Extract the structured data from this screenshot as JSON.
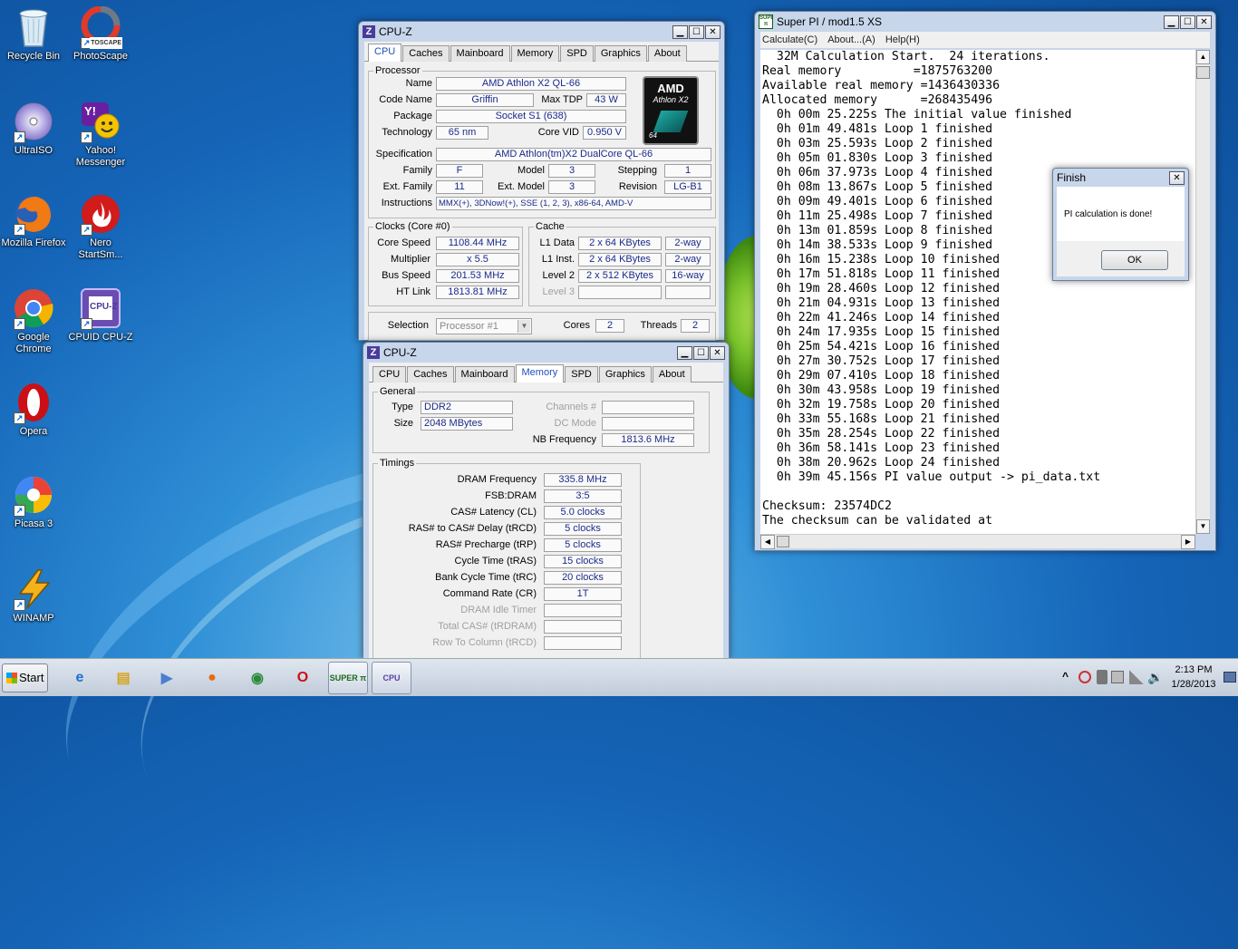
{
  "desktop": {
    "icons": [
      {
        "label": "Recycle Bin",
        "icon": "recycle-bin-icon"
      },
      {
        "label": "PhotoScape",
        "icon": "photoscape-icon"
      },
      {
        "label": "UltraISO",
        "icon": "ultraiso-icon"
      },
      {
        "label": "Yahoo! Messenger",
        "icon": "yahoo-messenger-icon"
      },
      {
        "label": "Mozilla Firefox",
        "icon": "firefox-icon"
      },
      {
        "label": "Nero StartSm...",
        "icon": "nero-icon"
      },
      {
        "label": "Google Chrome",
        "icon": "chrome-icon"
      },
      {
        "label": "CPUID CPU-Z",
        "icon": "cpuz-icon"
      },
      {
        "label": "Opera",
        "icon": "opera-icon"
      },
      {
        "label": "Picasa 3",
        "icon": "picasa-icon"
      },
      {
        "label": "WINAMP",
        "icon": "winamp-icon"
      }
    ],
    "shortcut_badge_label": "TOSCAPE",
    "cpuz_icon_label": "CPU-Z",
    "yahoo_icon_glyph": "Y!"
  },
  "cpuz_main": {
    "title": "CPU-Z",
    "tabs": [
      "CPU",
      "Caches",
      "Mainboard",
      "Memory",
      "SPD",
      "Graphics",
      "About"
    ],
    "active_tab": "CPU",
    "processor": {
      "group": "Processor",
      "name_label": "Name",
      "name": "AMD Athlon X2 QL-66",
      "codename_label": "Code Name",
      "codename": "Griffin",
      "maxtdp_label": "Max TDP",
      "maxtdp": "43 W",
      "package_label": "Package",
      "package": "Socket S1 (638)",
      "technology_label": "Technology",
      "technology": "65 nm",
      "corevid_label": "Core VID",
      "corevid": "0.950 V",
      "spec_label": "Specification",
      "spec": "AMD Athlon(tm)X2 DualCore QL-66",
      "family_label": "Family",
      "family": "F",
      "model_label": "Model",
      "model": "3",
      "stepping_label": "Stepping",
      "stepping": "1",
      "extfamily_label": "Ext. Family",
      "extfamily": "11",
      "extmodel_label": "Ext. Model",
      "extmodel": "3",
      "revision_label": "Revision",
      "revision": "LG-B1",
      "instructions_label": "Instructions",
      "instructions": "MMX(+), 3DNow!(+), SSE (1, 2, 3), x86-64, AMD-V",
      "logo_brand": "AMD",
      "logo_line": "Athlon X2",
      "logo_sub": "64"
    },
    "clocks": {
      "group": "Clocks (Core #0)",
      "core_speed_label": "Core Speed",
      "core_speed": "1108.44 MHz",
      "multiplier_label": "Multiplier",
      "multiplier": "x 5.5",
      "bus_speed_label": "Bus Speed",
      "bus_speed": "201.53 MHz",
      "ht_link_label": "HT Link",
      "ht_link": "1813.81 MHz"
    },
    "cache": {
      "group": "Cache",
      "l1d_label": "L1 Data",
      "l1d": "2 x 64 KBytes",
      "l1d_way": "2-way",
      "l1i_label": "L1 Inst.",
      "l1i": "2 x 64 KBytes",
      "l1i_way": "2-way",
      "l2_label": "Level 2",
      "l2": "2 x 512 KBytes",
      "l2_way": "16-way",
      "l3_label": "Level 3"
    },
    "selection_label": "Selection",
    "selection": "Processor #1",
    "cores_label": "Cores",
    "cores": "2",
    "threads_label": "Threads",
    "threads": "2"
  },
  "cpuz_mem": {
    "title": "CPU-Z",
    "tabs": [
      "CPU",
      "Caches",
      "Mainboard",
      "Memory",
      "SPD",
      "Graphics",
      "About"
    ],
    "active_tab": "Memory",
    "general": {
      "group": "General",
      "type_label": "Type",
      "type": "DDR2",
      "channels_label": "Channels #",
      "size_label": "Size",
      "size": "2048 MBytes",
      "dcmode_label": "DC Mode",
      "nbfreq_label": "NB Frequency",
      "nbfreq": "1813.6 MHz"
    },
    "timings": {
      "group": "Timings",
      "rows": [
        {
          "label": "DRAM Frequency",
          "value": "335.8 MHz",
          "dim": false
        },
        {
          "label": "FSB:DRAM",
          "value": "3:5",
          "dim": false
        },
        {
          "label": "CAS# Latency (CL)",
          "value": "5.0 clocks",
          "dim": false
        },
        {
          "label": "RAS# to CAS# Delay (tRCD)",
          "value": "5 clocks",
          "dim": false
        },
        {
          "label": "RAS# Precharge (tRP)",
          "value": "5 clocks",
          "dim": false
        },
        {
          "label": "Cycle Time (tRAS)",
          "value": "15 clocks",
          "dim": false
        },
        {
          "label": "Bank Cycle Time (tRC)",
          "value": "20 clocks",
          "dim": false
        },
        {
          "label": "Command Rate (CR)",
          "value": "1T",
          "dim": false
        },
        {
          "label": "DRAM Idle Timer",
          "value": "",
          "dim": true
        },
        {
          "label": "Total CAS# (tRDRAM)",
          "value": "",
          "dim": true
        },
        {
          "label": "Row To Column (tRCD)",
          "value": "",
          "dim": true
        }
      ]
    }
  },
  "superpi": {
    "title": "Super PI / mod1.5 XS",
    "menu": [
      "Calculate(C)",
      "About...(A)",
      "Help(H)"
    ],
    "lines": [
      "  32M Calculation Start.  24 iterations.",
      "Real memory          =1875763200",
      "Available real memory =1436430336",
      "Allocated memory      =268435496",
      "  0h 00m 25.225s The initial value finished",
      "  0h 01m 49.481s Loop 1 finished",
      "  0h 03m 25.593s Loop 2 finished",
      "  0h 05m 01.830s Loop 3 finished",
      "  0h 06m 37.973s Loop 4 finished",
      "  0h 08m 13.867s Loop 5 finished",
      "  0h 09m 49.401s Loop 6 finished",
      "  0h 11m 25.498s Loop 7 finished",
      "  0h 13m 01.859s Loop 8 finished",
      "  0h 14m 38.533s Loop 9 finished",
      "  0h 16m 15.238s Loop 10 finished",
      "  0h 17m 51.818s Loop 11 finished",
      "  0h 19m 28.460s Loop 12 finished",
      "  0h 21m 04.931s Loop 13 finished",
      "  0h 22m 41.246s Loop 14 finished",
      "  0h 24m 17.935s Loop 15 finished",
      "  0h 25m 54.421s Loop 16 finished",
      "  0h 27m 30.752s Loop 17 finished",
      "  0h 29m 07.410s Loop 18 finished",
      "  0h 30m 43.958s Loop 19 finished",
      "  0h 32m 19.758s Loop 20 finished",
      "  0h 33m 55.168s Loop 21 finished",
      "  0h 35m 28.254s Loop 22 finished",
      "  0h 36m 58.141s Loop 23 finished",
      "  0h 38m 20.962s Loop 24 finished",
      "  0h 39m 45.156s PI value output -> pi_data.txt",
      "",
      "Checksum: 23574DC2",
      "The checksum can be validated at"
    ],
    "logo_text": "SUPER π"
  },
  "finish_dialog": {
    "title": "Finish",
    "message": "PI calculation is done!",
    "ok_label": "OK"
  },
  "taskbar": {
    "start_label": "Start",
    "pinned": [
      {
        "icon": "internet-explorer-icon",
        "glyph": "e",
        "open": false
      },
      {
        "icon": "explorer-folder-icon",
        "glyph": "▤",
        "open": false
      },
      {
        "icon": "media-player-icon",
        "glyph": "▶",
        "open": false
      },
      {
        "icon": "firefox-icon",
        "glyph": "●",
        "open": false
      },
      {
        "icon": "chrome-icon",
        "glyph": "◉",
        "open": false
      },
      {
        "icon": "opera-icon",
        "glyph": "O",
        "open": false
      },
      {
        "icon": "superpi-icon",
        "glyph": "SUPER π",
        "open": true
      },
      {
        "icon": "cpuz-icon",
        "glyph": "CPU",
        "open": true
      }
    ],
    "tray_expand": "^",
    "time": "2:13 PM",
    "date": "1/28/2013"
  }
}
